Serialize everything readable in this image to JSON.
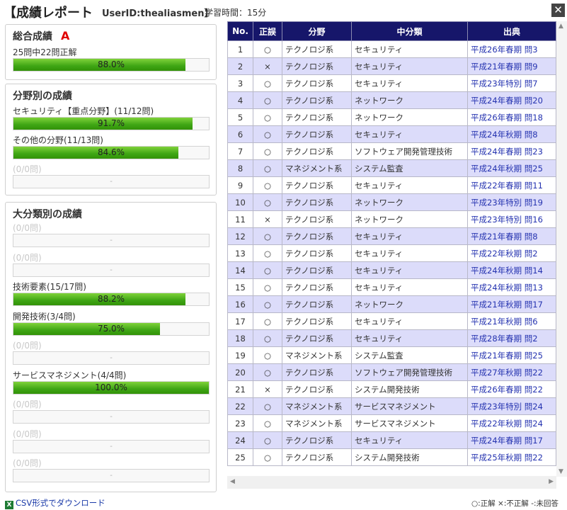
{
  "header": {
    "title": "【成績レポート",
    "user_id": "UserID:thealiasmen】",
    "study_time": "学習時間：15分",
    "close_glyph": "✕"
  },
  "overall": {
    "heading": "総合成績",
    "grade": "A",
    "summary": "25問中22問正解",
    "percent_label": "88.0%",
    "percent": 88.0
  },
  "field": {
    "heading": "分野別の成績",
    "items": [
      {
        "label": "セキュリティ【重点分野】(11/12問)",
        "bar_text": "91.7%",
        "percent": 91.7
      },
      {
        "label": "その他の分野(11/13問)",
        "bar_text": "84.6%",
        "percent": 84.6
      },
      {
        "label": "(0/0問)",
        "bar_text": "-",
        "percent": 0
      }
    ]
  },
  "major": {
    "heading": "大分類別の成績",
    "items": [
      {
        "label": "(0/0問)",
        "bar_text": "-",
        "percent": 0
      },
      {
        "label": "(0/0問)",
        "bar_text": "-",
        "percent": 0
      },
      {
        "label": "技術要素(15/17問)",
        "bar_text": "88.2%",
        "percent": 88.2
      },
      {
        "label": "開発技術(3/4問)",
        "bar_text": "75.0%",
        "percent": 75.0
      },
      {
        "label": "(0/0問)",
        "bar_text": "-",
        "percent": 0
      },
      {
        "label": "サービスマネジメント(4/4問)",
        "bar_text": "100.0%",
        "percent": 100.0
      },
      {
        "label": "(0/0問)",
        "bar_text": "-",
        "percent": 0
      },
      {
        "label": "(0/0問)",
        "bar_text": "-",
        "percent": 0
      },
      {
        "label": "(0/0問)",
        "bar_text": "-",
        "percent": 0
      }
    ]
  },
  "table": {
    "headers": [
      "No.",
      "正誤",
      "分野",
      "中分類",
      "出典"
    ],
    "rows": [
      [
        "1",
        "○",
        "テクノロジ系",
        "セキュリティ",
        "平成26年春期 問3"
      ],
      [
        "2",
        "×",
        "テクノロジ系",
        "セキュリティ",
        "平成21年春期 問9"
      ],
      [
        "3",
        "○",
        "テクノロジ系",
        "セキュリティ",
        "平成23年特別 問7"
      ],
      [
        "4",
        "○",
        "テクノロジ系",
        "ネットワーク",
        "平成24年春期 問20"
      ],
      [
        "5",
        "○",
        "テクノロジ系",
        "ネットワーク",
        "平成26年春期 問18"
      ],
      [
        "6",
        "○",
        "テクノロジ系",
        "セキュリティ",
        "平成24年秋期 問8"
      ],
      [
        "7",
        "○",
        "テクノロジ系",
        "ソフトウェア開発管理技術",
        "平成24年春期 問23"
      ],
      [
        "8",
        "○",
        "マネジメント系",
        "システム監査",
        "平成24年秋期 問25"
      ],
      [
        "9",
        "○",
        "テクノロジ系",
        "セキュリティ",
        "平成22年春期 問11"
      ],
      [
        "10",
        "○",
        "テクノロジ系",
        "ネットワーク",
        "平成23年特別 問19"
      ],
      [
        "11",
        "×",
        "テクノロジ系",
        "ネットワーク",
        "平成23年特別 問16"
      ],
      [
        "12",
        "○",
        "テクノロジ系",
        "セキュリティ",
        "平成21年春期 問8"
      ],
      [
        "13",
        "○",
        "テクノロジ系",
        "セキュリティ",
        "平成22年秋期 問2"
      ],
      [
        "14",
        "○",
        "テクノロジ系",
        "セキュリティ",
        "平成24年秋期 問14"
      ],
      [
        "15",
        "○",
        "テクノロジ系",
        "セキュリティ",
        "平成24年秋期 問13"
      ],
      [
        "16",
        "○",
        "テクノロジ系",
        "ネットワーク",
        "平成21年秋期 問17"
      ],
      [
        "17",
        "○",
        "テクノロジ系",
        "セキュリティ",
        "平成21年秋期 問6"
      ],
      [
        "18",
        "○",
        "テクノロジ系",
        "セキュリティ",
        "平成28年春期 問2"
      ],
      [
        "19",
        "○",
        "マネジメント系",
        "システム監査",
        "平成21年春期 問25"
      ],
      [
        "20",
        "○",
        "テクノロジ系",
        "ソフトウェア開発管理技術",
        "平成27年秋期 問22"
      ],
      [
        "21",
        "×",
        "テクノロジ系",
        "システム開発技術",
        "平成26年春期 問22"
      ],
      [
        "22",
        "○",
        "マネジメント系",
        "サービスマネジメント",
        "平成23年特別 問24"
      ],
      [
        "23",
        "○",
        "マネジメント系",
        "サービスマネジメント",
        "平成22年秋期 問24"
      ],
      [
        "24",
        "○",
        "テクノロジ系",
        "セキュリティ",
        "平成24年春期 問17"
      ],
      [
        "25",
        "○",
        "テクノロジ系",
        "システム開発技術",
        "平成25年秋期 問22"
      ]
    ]
  },
  "footer": {
    "csv_icon": "X",
    "csv_link": "CSV形式でダウンロード",
    "legend": "○:正解 ×:不正解 -:未回答"
  },
  "colors": {
    "table_header_bg": "#16166a",
    "row_alt_bg": "#dcdcfa",
    "bar_fill": "#3ea514",
    "grade_red": "#e00000",
    "source_link": "#2533b0"
  }
}
